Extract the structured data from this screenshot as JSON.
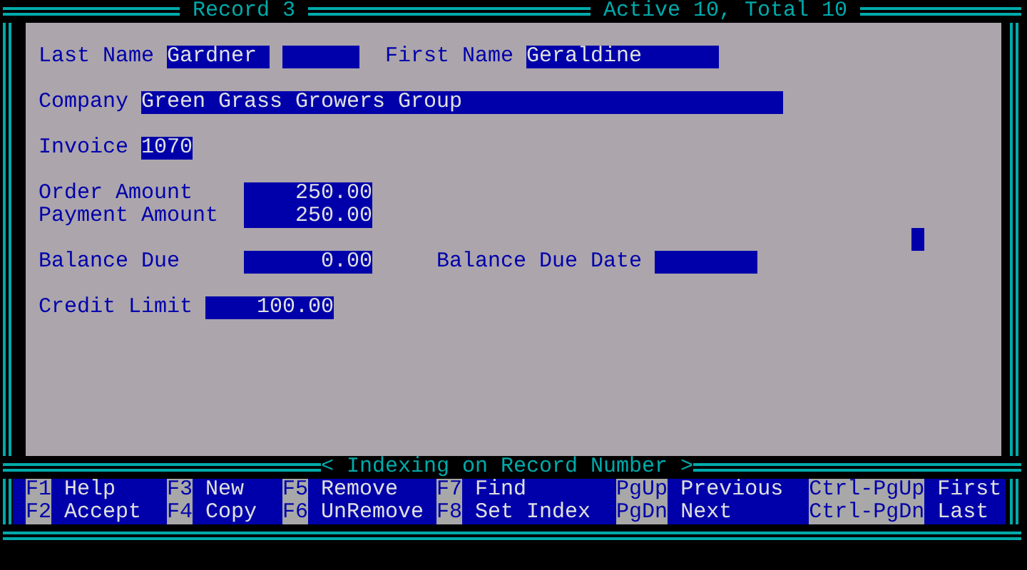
{
  "window": {
    "title": "Record 3",
    "record_count": "Active 10, Total 10",
    "status": "< Indexing on Record Number >"
  },
  "form": {
    "rows": [
      [
        {
          "label": "Last Name",
          "value": "Gardner",
          "kind": "text",
          "cursor": true
        },
        {
          "label": "First Name",
          "value": "Geraldine",
          "kind": "text",
          "cursor": false
        }
      ],
      [
        {
          "label": "Company",
          "value": "Green Grass Growers Group",
          "kind": "text",
          "cursor": false
        }
      ],
      [
        {
          "label": "Invoice",
          "value": "1070",
          "kind": "text",
          "cursor": false
        }
      ],
      [
        {
          "label": "Order Amount",
          "value": "250.00",
          "kind": "number",
          "cursor": false
        }
      ],
      [
        {
          "label": "Payment Amount",
          "value": "250.00",
          "kind": "number",
          "cursor": false
        }
      ],
      [
        {
          "label": "Balance Due",
          "value": "0.00",
          "kind": "number",
          "cursor": false
        },
        {
          "label": "Balance Due Date",
          "kind": "text",
          "cursor": false
        }
      ],
      [
        {
          "label": "Credit Limit",
          "value": "100.00",
          "kind": "number",
          "cursor": false
        }
      ]
    ]
  },
  "function_keys": [
    [
      {
        "key": "F1",
        "label": "Help"
      },
      {
        "key": "F2",
        "label": "Accept"
      }
    ],
    [
      {
        "key": "F3",
        "label": "New"
      },
      {
        "key": "F4",
        "label": "Copy"
      }
    ],
    [
      {
        "key": "F5",
        "label": "Remove"
      },
      {
        "key": "F6",
        "label": "UnRemove"
      }
    ],
    [
      {
        "key": "F7",
        "label": "Find"
      },
      {
        "key": "F8",
        "label": "Set Index"
      }
    ],
    [
      {
        "key": "PgUp",
        "label": "Previous"
      },
      {
        "key": "PgDn",
        "label": "Next"
      }
    ],
    [
      {
        "key": "Ctrl-PgUp",
        "label": "First"
      },
      {
        "key": "Ctrl-PgDn",
        "label": "Last"
      }
    ]
  ]
}
